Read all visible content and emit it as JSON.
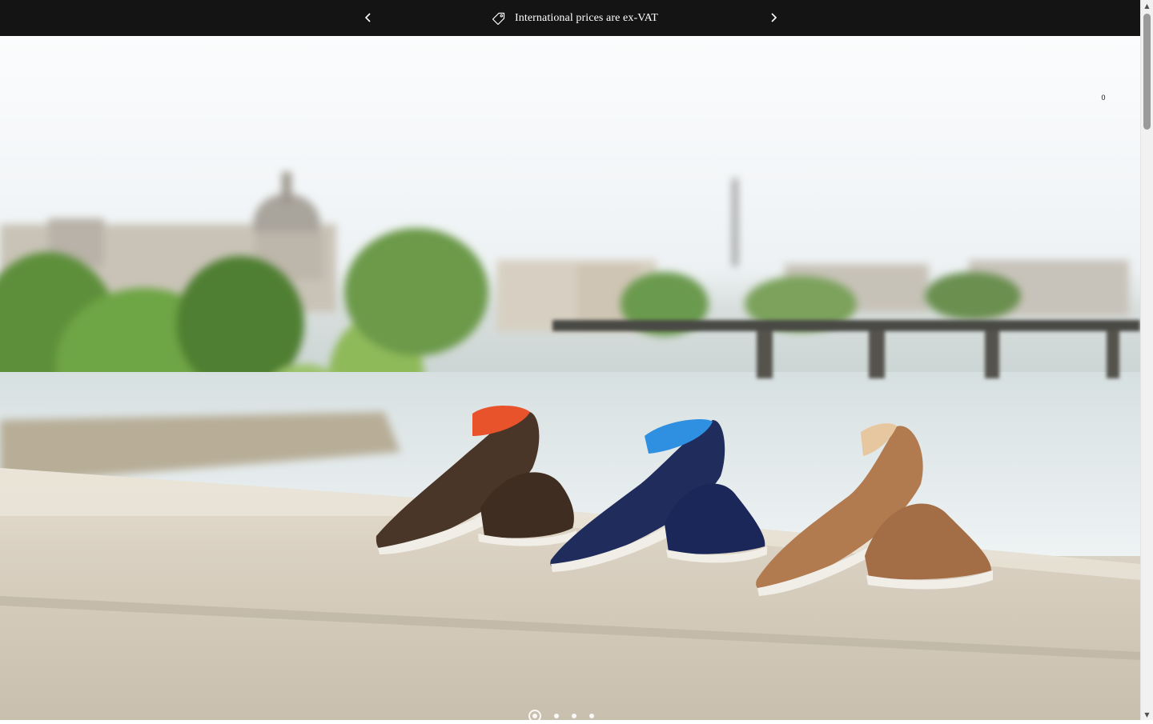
{
  "announcement": {
    "message": "International prices are ex-VAT",
    "icon": "price-tag-icon",
    "prev_icon": "chevron-left-icon",
    "next_icon": "chevron-right-icon"
  },
  "header": {
    "cart_count": "0"
  },
  "hero": {
    "slide_count": 4,
    "active_slide": 1,
    "products": [
      {
        "color_name": "brown suede",
        "hex": "#4a3628",
        "lining": "#e8532c"
      },
      {
        "color_name": "navy suede",
        "hex": "#1f2c5c",
        "lining": "#2f8fe0"
      },
      {
        "color_name": "tan suede",
        "hex": "#b27a4f",
        "lining": "#e6c7a0"
      }
    ]
  },
  "colors": {
    "bar_background": "#141414",
    "bar_text": "#ffffff"
  }
}
